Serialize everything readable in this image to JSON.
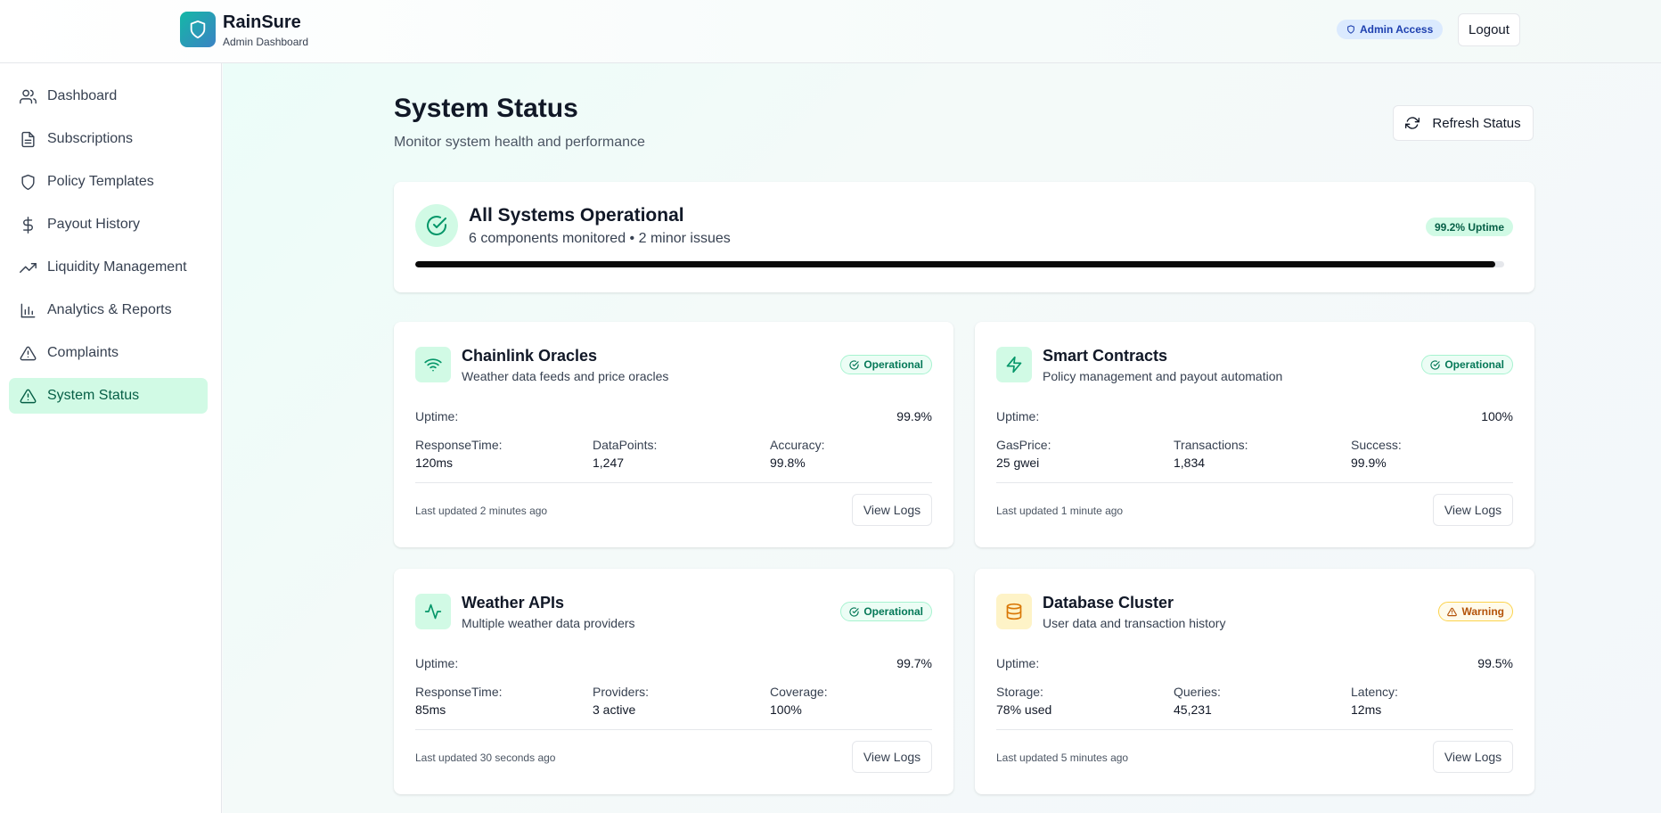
{
  "app": {
    "name": "RainSure",
    "subtitle": "Admin Dashboard"
  },
  "header": {
    "admin_badge": "Admin Access",
    "logout_label": "Logout"
  },
  "sidebar": {
    "items": [
      {
        "label": "Dashboard",
        "icon": "users-icon"
      },
      {
        "label": "Subscriptions",
        "icon": "file-text-icon"
      },
      {
        "label": "Policy Templates",
        "icon": "shield-icon"
      },
      {
        "label": "Payout History",
        "icon": "dollar-icon"
      },
      {
        "label": "Liquidity Management",
        "icon": "trending-up-icon"
      },
      {
        "label": "Analytics & Reports",
        "icon": "bar-chart-icon"
      },
      {
        "label": "Complaints",
        "icon": "alert-triangle-icon"
      },
      {
        "label": "System Status",
        "icon": "alert-triangle-icon",
        "active": true
      }
    ]
  },
  "page": {
    "title": "System Status",
    "subtitle": "Monitor system health and performance",
    "refresh_label": "Refresh Status"
  },
  "overview": {
    "title": "All Systems Operational",
    "summary": "6 components monitored • 2 minor issues",
    "uptime_badge": "99.2% Uptime",
    "progress_fraction": 0.992
  },
  "components": [
    {
      "name": "Chainlink Oracles",
      "description": "Weather data feeds and price oracles",
      "icon": "wifi-icon",
      "status": "Operational",
      "status_type": "operational",
      "uptime_label": "Uptime:",
      "uptime": "99.9%",
      "metrics": [
        {
          "label": "ResponseTime:",
          "value": "120ms"
        },
        {
          "label": "DataPoints:",
          "value": "1,247"
        },
        {
          "label": "Accuracy:",
          "value": "99.8%"
        }
      ],
      "updated": "Last updated 2 minutes ago",
      "logs_label": "View Logs"
    },
    {
      "name": "Smart Contracts",
      "description": "Policy management and payout automation",
      "icon": "zap-icon",
      "status": "Operational",
      "status_type": "operational",
      "uptime_label": "Uptime:",
      "uptime": "100%",
      "metrics": [
        {
          "label": "GasPrice:",
          "value": "25 gwei"
        },
        {
          "label": "Transactions:",
          "value": "1,834"
        },
        {
          "label": "Success:",
          "value": "99.9%"
        }
      ],
      "updated": "Last updated 1 minute ago",
      "logs_label": "View Logs"
    },
    {
      "name": "Weather APIs",
      "description": "Multiple weather data providers",
      "icon": "activity-icon",
      "status": "Operational",
      "status_type": "operational",
      "uptime_label": "Uptime:",
      "uptime": "99.7%",
      "metrics": [
        {
          "label": "ResponseTime:",
          "value": "85ms"
        },
        {
          "label": "Providers:",
          "value": "3 active"
        },
        {
          "label": "Coverage:",
          "value": "100%"
        }
      ],
      "updated": "Last updated 30 seconds ago",
      "logs_label": "View Logs"
    },
    {
      "name": "Database Cluster",
      "description": "User data and transaction history",
      "icon": "database-icon",
      "status": "Warning",
      "status_type": "warning",
      "uptime_label": "Uptime:",
      "uptime": "99.5%",
      "metrics": [
        {
          "label": "Storage:",
          "value": "78% used"
        },
        {
          "label": "Queries:",
          "value": "45,231"
        },
        {
          "label": "Latency:",
          "value": "12ms"
        }
      ],
      "updated": "Last updated 5 minutes ago",
      "logs_label": "View Logs"
    }
  ],
  "colors": {
    "accent": "#10b981",
    "active_nav_bg": "#d1fae5",
    "warning": "#d97706",
    "progress": "#0a0a0a"
  }
}
